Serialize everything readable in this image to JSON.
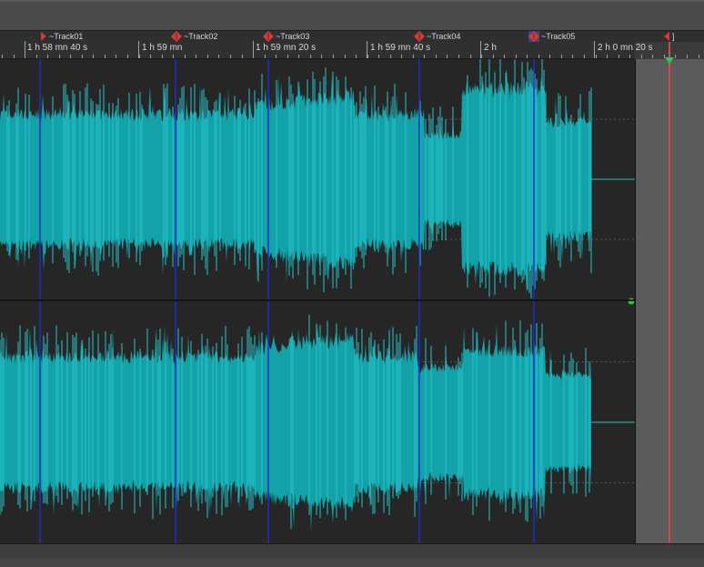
{
  "colors": {
    "waveform": "#12a2a8",
    "waveform_peak": "#27c4cc",
    "marker_line": "#1d2ec8",
    "marker_flag": "#d53a3a",
    "cursor": "#d84848",
    "envelope_point": "#22cc44"
  },
  "markers": [
    {
      "label": "~Track01",
      "kind": "start-flag-icon"
    },
    {
      "label": "~Track02",
      "kind": "diamond-marker-icon"
    },
    {
      "label": "~Track03",
      "kind": "diamond-marker-icon"
    },
    {
      "label": "~Track04",
      "kind": "diamond-marker-icon"
    },
    {
      "label": "~Track05",
      "kind": "diamond-marker-icon"
    },
    {
      "label": "]",
      "kind": "end-flag-icon"
    }
  ],
  "ruler": {
    "labels": [
      "1 h 58 mn 40 s",
      "1 h 59 mn",
      "1 h 59 mn 20 s",
      "1 h 59 mn 40 s",
      "2 h",
      "2 h 0 mn 20 s"
    ]
  }
}
